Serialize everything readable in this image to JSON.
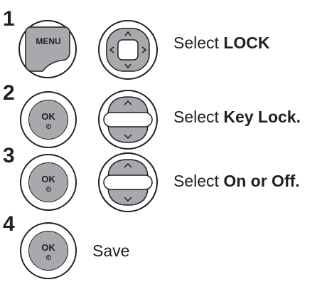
{
  "steps": [
    {
      "number": "1",
      "button_label": "MENU",
      "instruction_prefix": "Select ",
      "instruction_bold": "LOCK"
    },
    {
      "number": "2",
      "button_label": "OK",
      "instruction_prefix": "Select ",
      "instruction_bold": "Key Lock."
    },
    {
      "number": "3",
      "button_label": "OK",
      "instruction_prefix": "Select ",
      "instruction_bold": "On or Off."
    },
    {
      "number": "4",
      "button_label": "OK",
      "instruction_prefix": "Save",
      "instruction_bold": ""
    }
  ],
  "icons": {
    "menu_button": "menu-button-icon",
    "ok_button": "ok-button-icon",
    "four_way": "four-way-navigation-icon",
    "up_down": "up-down-navigation-icon"
  }
}
